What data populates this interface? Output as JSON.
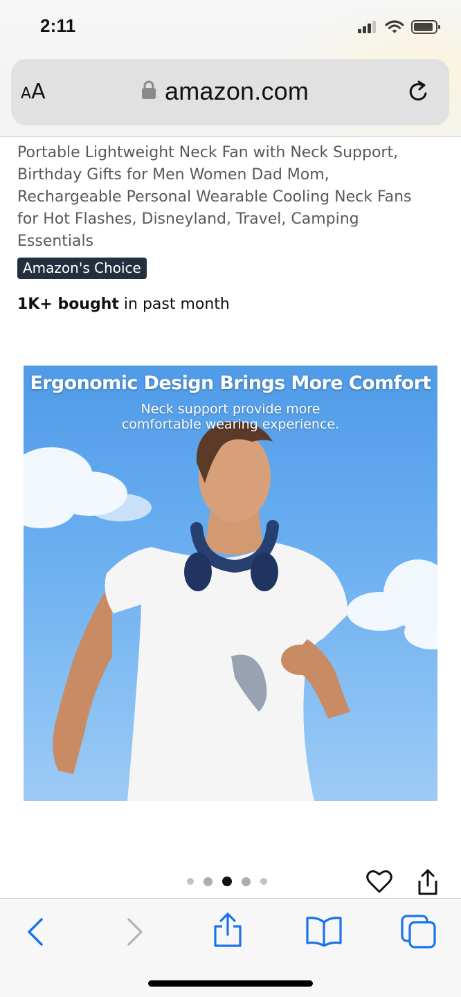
{
  "status_bar": {
    "time": "2:11"
  },
  "browser": {
    "text_size_small": "A",
    "text_size_large": "A",
    "url": "amazon.com"
  },
  "product": {
    "title": "Portable Lightweight Neck Fan with Neck Support, Birthday Gifts for Men Women Dad Mom, Rechargeable Personal Wearable Cooling Neck Fans for Hot Flashes, Disneyland, Travel, Camping Essentials",
    "badge": "Amazon's Choice",
    "bought_bold": "1K+ bought",
    "bought_rest": " in past month"
  },
  "image": {
    "headline": "Ergonomic Design Brings More Comfort",
    "subline_1": "Neck support provide more",
    "subline_2": "comfortable wearing experience."
  },
  "carousel": {
    "count": 5,
    "active_index": 2
  },
  "icons": {
    "lock": "lock-icon",
    "reload": "reload-icon",
    "heart": "heart-icon",
    "share": "share-icon",
    "back": "chevron-left-icon",
    "forward": "chevron-right-icon",
    "bookmarks": "book-icon",
    "tabs": "tabs-icon"
  },
  "colors": {
    "accent": "#1a73e8",
    "badge_bg": "#232f3e",
    "title_text": "#565959"
  }
}
